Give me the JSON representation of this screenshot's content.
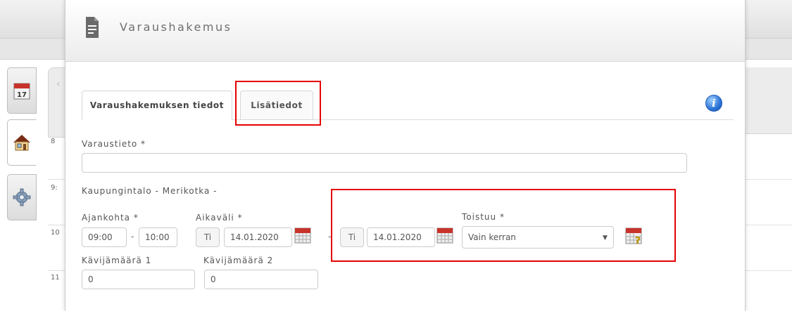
{
  "dialog": {
    "title": "Varaushakemus",
    "tabs": [
      {
        "label": "Varaushakemuksen tiedot",
        "active": true
      },
      {
        "label": "Lisätiedot",
        "active": false
      }
    ],
    "info_icon": "info-icon"
  },
  "background": {
    "hours": [
      "8",
      "9:",
      "10",
      "11"
    ],
    "side_tabs": [
      "calendar-icon",
      "house-icon",
      "gear-icon"
    ],
    "calendar_icon_day": "17"
  },
  "form": {
    "varaustieto": {
      "label": "Varaustieto *",
      "value": ""
    },
    "location_text": "Kaupungintalo - Merikotka -",
    "ajankohta": {
      "label": "Ajankohta *",
      "start": "09:00",
      "separator": "-",
      "end": "10:00"
    },
    "aikavali": {
      "label": "Aikaväli *",
      "start_day": "Ti",
      "start_date": "14.01.2020",
      "separator": "-",
      "end_day": "Ti",
      "end_date": "14.01.2020"
    },
    "toistuu": {
      "label": "Toistuu *",
      "selected": "Vain kerran"
    },
    "kavijamaara1": {
      "label": "Kävijämäärä 1",
      "value": "0"
    },
    "kavijamaara2": {
      "label": "Kävijämäärä 2",
      "value": "0"
    }
  },
  "colors": {
    "highlight": "#e60000",
    "info": "#2c74d6"
  }
}
